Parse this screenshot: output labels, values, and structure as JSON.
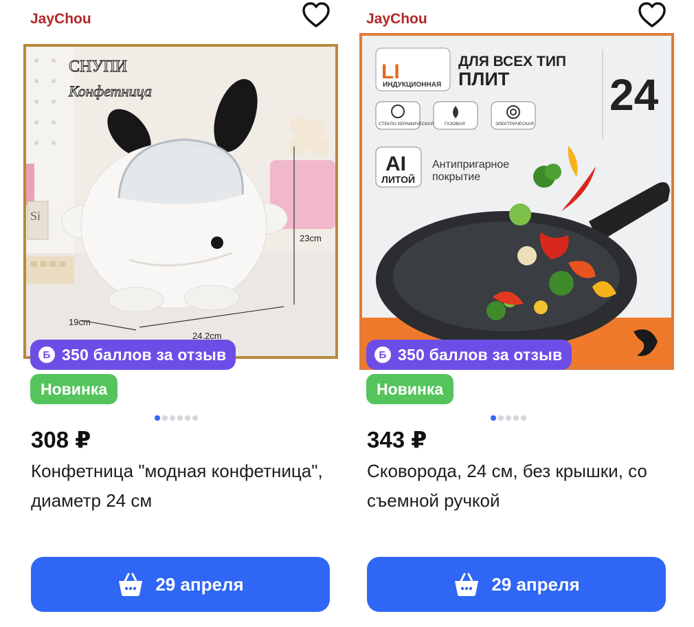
{
  "products": [
    {
      "seller": "JayChou",
      "points_label": "350 баллов за отзыв",
      "points_icon": "Б",
      "badge": "Новинка",
      "price": "308 ₽",
      "title": "Конфетница \"модная конфетница\", диаметр 24 см",
      "buy_label": "29 апреля",
      "image": {
        "heading1": "СНУПИ",
        "heading2": "Конфетница",
        "dim_height": "23cm",
        "dim_depth": "19cm",
        "dim_width": "24.2cm",
        "book_text": "Si"
      }
    },
    {
      "seller": "JayChou",
      "points_label": "350 баллов за отзыв",
      "points_icon": "Б",
      "badge": "Новинка",
      "price": "343 ₽",
      "title": "Сковорода, 24 см, без крышки, со съемной ручкой",
      "buy_label": "29 апреля",
      "image": {
        "banner1": "ДЛЯ ВСЕХ ТИП",
        "banner2": "ПЛИТ",
        "size": "24",
        "induction": "ИНДУКЦИОННАЯ",
        "stove_glass": "СТЕКЛО КЕРАМИЧЕСКАЯ",
        "stove_gas": "ГАЗОВАЯ",
        "stove_electric": "ЭЛЕКТРИЧЕСКАЯ",
        "ai": "AI",
        "cast": "ЛИТОЙ",
        "coating1": "Антипригарное",
        "coating2": "покрытие"
      }
    }
  ],
  "colors": {
    "seller": "#b3262a",
    "points_bg": "#6c4ee6",
    "badge_bg": "#55c45c",
    "button_bg": "#2f66f5",
    "dot_active": "#2f66f5",
    "dot_inactive": "#d4d6dc"
  }
}
